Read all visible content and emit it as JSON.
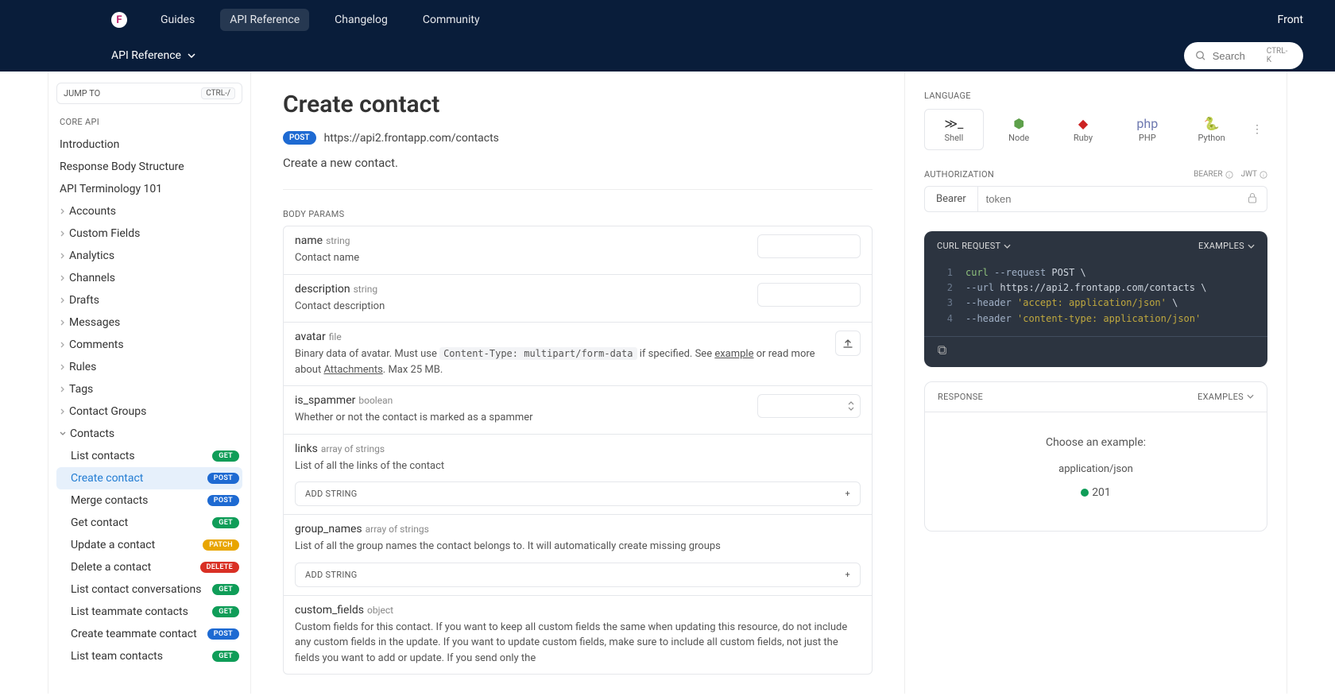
{
  "header": {
    "nav": [
      "Guides",
      "API Reference",
      "Changelog",
      "Community"
    ],
    "active_nav": "API Reference",
    "brand": "Front",
    "sub_title": "API Reference",
    "search_placeholder": "Search",
    "search_kbd": "CTRL-K"
  },
  "sidebar": {
    "jump_to": "JUMP TO",
    "jump_kbd": "CTRL-/",
    "section_label": "CORE API",
    "plain_items": [
      "Introduction",
      "Response Body Structure",
      "API Terminology 101"
    ],
    "group_items": [
      "Accounts",
      "Custom Fields",
      "Analytics",
      "Channels",
      "Drafts",
      "Messages",
      "Comments",
      "Rules",
      "Tags",
      "Contact Groups"
    ],
    "expanded_group": "Contacts",
    "contacts": [
      {
        "label": "List contacts",
        "method": "GET"
      },
      {
        "label": "Create contact",
        "method": "POST",
        "active": true
      },
      {
        "label": "Merge contacts",
        "method": "POST"
      },
      {
        "label": "Get contact",
        "method": "GET"
      },
      {
        "label": "Update a contact",
        "method": "PATCH"
      },
      {
        "label": "Delete a contact",
        "method": "DELETE"
      },
      {
        "label": "List contact conversations",
        "method": "GET"
      },
      {
        "label": "List teammate contacts",
        "method": "GET"
      },
      {
        "label": "Create teammate contact",
        "method": "POST"
      },
      {
        "label": "List team contacts",
        "method": "GET"
      }
    ]
  },
  "page": {
    "title": "Create contact",
    "method": "POST",
    "url": "https://api2.frontapp.com/contacts",
    "description": "Create a new contact.",
    "body_params_label": "BODY PARAMS",
    "params": [
      {
        "name": "name",
        "type": "string",
        "desc": "Contact name",
        "input": true
      },
      {
        "name": "description",
        "type": "string",
        "desc": "Contact description",
        "input": true
      },
      {
        "name": "avatar",
        "type": "file",
        "desc_pre": "Binary data of avatar. Must use ",
        "code": "Content-Type: multipart/form-data",
        "desc_mid": " if specified. See ",
        "link1": "example",
        "desc_mid2": " or read more about ",
        "link2": "Attachments",
        "desc_post": ". Max 25 MB.",
        "upload": true
      },
      {
        "name": "is_spammer",
        "type": "boolean",
        "desc": "Whether or not the contact is marked as a spammer",
        "select": true
      },
      {
        "name": "links",
        "type": "array of strings",
        "desc": "List of all the links of the contact",
        "add_string": true
      },
      {
        "name": "group_names",
        "type": "array of strings",
        "desc": "List of all the group names the contact belongs to. It will automatically create missing groups",
        "add_string": true
      },
      {
        "name": "custom_fields",
        "type": "object",
        "desc": "Custom fields for this contact. If you want to keep all custom fields the same when updating this resource, do not include any custom fields in the update. If you want to update custom fields, make sure to include all custom fields, not just the fields you want to add or update. If you send only the"
      }
    ],
    "add_string_label": "ADD STRING"
  },
  "right": {
    "language_label": "LANGUAGE",
    "langs": [
      "Shell",
      "Node",
      "Ruby",
      "PHP",
      "Python"
    ],
    "active_lang": "Shell",
    "auth_label": "AUTHORIZATION",
    "auth_types": [
      "BEARER",
      "JWT"
    ],
    "auth_prefix": "Bearer",
    "auth_placeholder": "token",
    "code_title": "CURL REQUEST",
    "examples_label": "EXAMPLES",
    "response_label": "RESPONSE",
    "response_prompt": "Choose an example:",
    "response_mime": "application/json",
    "response_status": "201",
    "code_lines": [
      {
        "n": "1",
        "parts": [
          {
            "c": "tok-cmd",
            "t": "curl"
          },
          {
            "c": "",
            "t": " "
          },
          {
            "c": "tok-flag",
            "t": "--request"
          },
          {
            "c": "",
            "t": " "
          },
          {
            "c": "tok-method",
            "t": "POST"
          },
          {
            "c": "",
            "t": " \\"
          }
        ]
      },
      {
        "n": "2",
        "parts": [
          {
            "c": "",
            "t": "     "
          },
          {
            "c": "tok-flag",
            "t": "--url"
          },
          {
            "c": "",
            "t": " https://api2.frontapp.com/contacts \\"
          }
        ]
      },
      {
        "n": "3",
        "parts": [
          {
            "c": "",
            "t": "     "
          },
          {
            "c": "tok-flag",
            "t": "--header"
          },
          {
            "c": "",
            "t": " "
          },
          {
            "c": "tok-str",
            "t": "'accept: application/json'"
          },
          {
            "c": "",
            "t": " \\"
          }
        ]
      },
      {
        "n": "4",
        "parts": [
          {
            "c": "",
            "t": "     "
          },
          {
            "c": "tok-flag",
            "t": "--header"
          },
          {
            "c": "",
            "t": " "
          },
          {
            "c": "tok-str",
            "t": "'content-type: application/json'"
          }
        ]
      }
    ]
  }
}
